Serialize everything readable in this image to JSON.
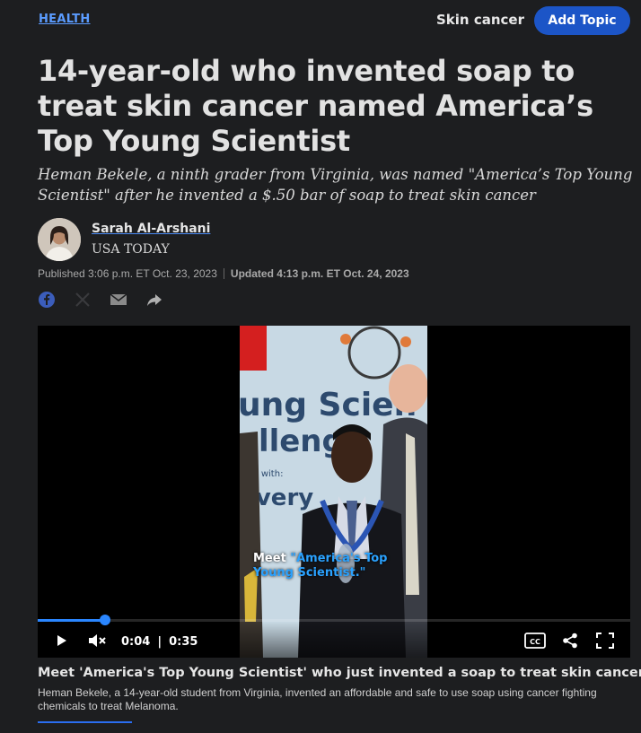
{
  "header": {
    "section": "HEALTH",
    "topic": "Skin cancer",
    "add_topic": "Add Topic"
  },
  "article": {
    "headline": "14-year-old who invented soap to treat skin cancer named America’s Top Young Scientist",
    "dek": "Heman Bekele, a ninth grader from Virginia, was named \"America’s Top Young Scientist\" after he invented a $.50 bar of soap to treat skin cancer"
  },
  "byline": {
    "author": "Sarah Al-Arshani",
    "outlet": "USA TODAY",
    "published": "Published 3:06 p.m. ET Oct. 23, 2023",
    "updated": "Updated 4:13 p.m. ET Oct. 24, 2023"
  },
  "share_icons": [
    "facebook-icon",
    "x-icon",
    "email-icon",
    "share-icon"
  ],
  "video": {
    "overlay_prefix": "Meet ",
    "overlay_highlight": "\"America's Top Young Scientist.\"",
    "current_time": "0:04",
    "separator": "|",
    "duration": "0:35",
    "progress": 0.114,
    "accent_color": "#2a86ff",
    "title": "Meet 'America's Top Young Scientist' who just invented a soap to treat skin cancer.",
    "description": "Heman Bekele, a 14-year-old student from Virginia, invented an affordable and safe to use soap using cancer fighting chemicals to treat Melanoma."
  },
  "colors": {
    "background": "#1d1e20",
    "link": "#5b9cff",
    "button": "#1c55c7"
  }
}
